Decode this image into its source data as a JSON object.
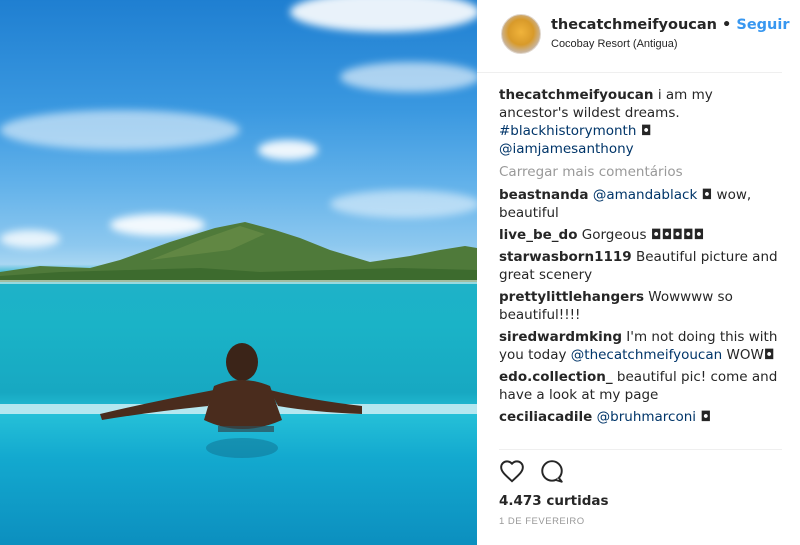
{
  "header": {
    "username": "thecatchmeifyoucan",
    "separator": "•",
    "follow_label": "Seguir",
    "location": "Cocobay Resort (Antigua)"
  },
  "caption": {
    "username": "thecatchmeifyoucan",
    "text": " i am my ancestor's wildest dreams. ",
    "hashtag": "#blackhistorymonth",
    "emoji": " ◘",
    "mention": "@iamjamesanthony"
  },
  "load_more_label": "Carregar mais comentários",
  "comments": [
    {
      "username": "beastnanda",
      "mention": "@amandablack",
      "text": " ◘ wow, beautiful"
    },
    {
      "username": "live_be_do",
      "mention": "",
      "text": " Gorgeous ◘◘◘◘◘"
    },
    {
      "username": "starwasborn1119",
      "mention": "",
      "text": " Beautiful picture and great scenery"
    },
    {
      "username": "prettylittlehangers",
      "mention": "",
      "text": " Wowwww so beautiful!!!!"
    },
    {
      "username": "siredwardmking",
      "mention": "",
      "text": " I'm not doing this with you today ",
      "mention2": "@thecatchmeifyoucan",
      "text2": " WOW◘"
    },
    {
      "username": "edo.collection_",
      "mention": "",
      "text": " beautiful pic! come and have a look at my page"
    },
    {
      "username": "ceciliacadile",
      "mention": "@bruhmarconi",
      "text": " ◘"
    }
  ],
  "actions": {
    "like_icon": "heart-icon",
    "comment_icon": "comment-bubble-icon"
  },
  "likes_label": "4.473 curtidas",
  "date_label": "1 DE FEVEREIRO",
  "colors": {
    "link_blue": "#3897f0",
    "tag_blue": "#003569",
    "muted_gray": "#999999",
    "text": "#262626"
  }
}
